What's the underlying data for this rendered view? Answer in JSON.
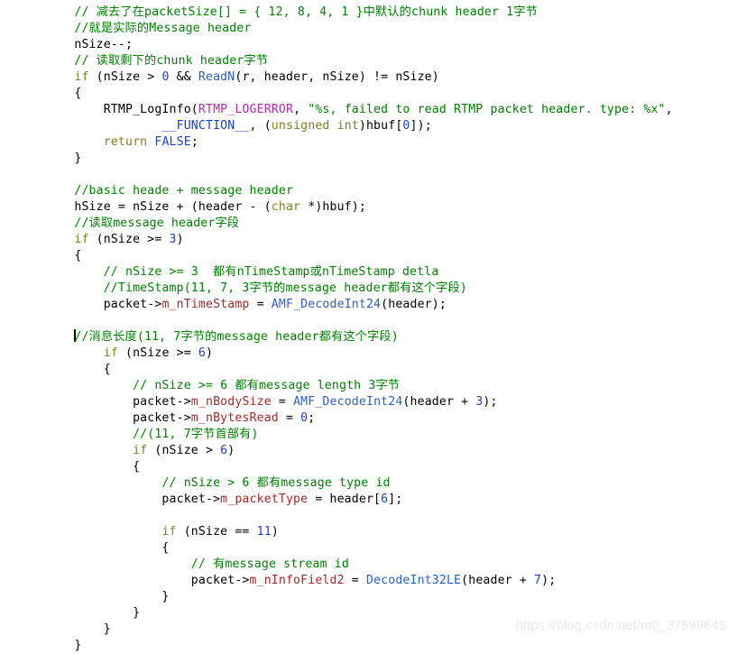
{
  "app": {
    "type": "code-editor-screenshot",
    "language": "C",
    "background_color": "#ffffff"
  },
  "theme": {
    "comment_color": "#008000",
    "keyword_color": "#7f7f23",
    "number_color": "#1c41c8",
    "function_color": "#2a5fc4",
    "member_color": "#9e2b2b",
    "macro_color": "#b02fb0",
    "string_color": "#008000",
    "plain_color": "#000000",
    "caret_color": "#000000",
    "watermark_color": "#e9e9e9"
  },
  "caret": {
    "visible": true,
    "line_index": 20,
    "column": 4
  },
  "watermark": {
    "text": "https://blog.csdn.net/m0_37599645"
  },
  "code": {
    "lines": [
      {
        "i": 0,
        "text": "    // 减去了在packetSize[] = { 12, 8, 4, 1 }中默认的chunk header 1字节"
      },
      {
        "i": 1,
        "text": "    //就是实际的Message header"
      },
      {
        "i": 2,
        "text": "    nSize--;"
      },
      {
        "i": 3,
        "text": "    // 读取剩下的chunk header字节"
      },
      {
        "i": 4,
        "text": "    if (nSize > 0 && ReadN(r, header, nSize) != nSize)"
      },
      {
        "i": 5,
        "text": "    {"
      },
      {
        "i": 6,
        "text": "        RTMP_LogInfo(RTMP_LOGERROR, \"%s, failed to read RTMP packet header. type: %x\","
      },
      {
        "i": 7,
        "text": "                __FUNCTION__, (unsigned int)hbuf[0]);"
      },
      {
        "i": 8,
        "text": "        return FALSE;"
      },
      {
        "i": 9,
        "text": "    }"
      },
      {
        "i": 10,
        "text": ""
      },
      {
        "i": 11,
        "text": "    //basic heade + message header"
      },
      {
        "i": 12,
        "text": "    hSize = nSize + (header - (char *)hbuf);"
      },
      {
        "i": 13,
        "text": "    //读取message header字段"
      },
      {
        "i": 14,
        "text": "    if (nSize >= 3)"
      },
      {
        "i": 15,
        "text": "    {"
      },
      {
        "i": 16,
        "text": "        // nSize >= 3  都有nTimeStamp或nTimeStamp detla"
      },
      {
        "i": 17,
        "text": "        //TimeStamp(11, 7, 3字节的message header都有这个字段)"
      },
      {
        "i": 18,
        "text": "        packet->m_nTimeStamp = AMF_DecodeInt24(header);"
      },
      {
        "i": 19,
        "text": ""
      },
      {
        "i": 20,
        "text": "    //消息长度(11, 7字节的message header都有这个字段)"
      },
      {
        "i": 21,
        "text": "        if (nSize >= 6)"
      },
      {
        "i": 22,
        "text": "        {"
      },
      {
        "i": 23,
        "text": "            // nSize >= 6 都有message length 3字节"
      },
      {
        "i": 24,
        "text": "            packet->m_nBodySize = AMF_DecodeInt24(header + 3);"
      },
      {
        "i": 25,
        "text": "            packet->m_nBytesRead = 0;"
      },
      {
        "i": 26,
        "text": "            //(11, 7字节首部有)"
      },
      {
        "i": 27,
        "text": "            if (nSize > 6)"
      },
      {
        "i": 28,
        "text": "            {"
      },
      {
        "i": 29,
        "text": "                // nSize > 6 都有message type id"
      },
      {
        "i": 30,
        "text": "                packet->m_packetType = header[6];"
      },
      {
        "i": 31,
        "text": ""
      },
      {
        "i": 32,
        "text": "                if (nSize == 11)"
      },
      {
        "i": 33,
        "text": "                {"
      },
      {
        "i": 34,
        "text": "                    // 有message stream id"
      },
      {
        "i": 35,
        "text": "                    packet->m_nInfoField2 = DecodeInt32LE(header + 7);"
      },
      {
        "i": 36,
        "text": "                }"
      },
      {
        "i": 37,
        "text": "            }"
      },
      {
        "i": 38,
        "text": "        }"
      },
      {
        "i": 39,
        "text": "    }"
      }
    ],
    "tokens": [
      [
        {
          "t": "    ",
          "c": "p"
        },
        {
          "t": "// 减去了在packetSize[] = { 12, 8, 4, 1 }中默认的chunk header 1字节",
          "c": "c"
        }
      ],
      [
        {
          "t": "    ",
          "c": "p"
        },
        {
          "t": "//就是实际的Message header",
          "c": "c"
        }
      ],
      [
        {
          "t": "    nSize--;",
          "c": "p"
        }
      ],
      [
        {
          "t": "    ",
          "c": "p"
        },
        {
          "t": "// 读取剩下的chunk header字节",
          "c": "c"
        }
      ],
      [
        {
          "t": "    ",
          "c": "p"
        },
        {
          "t": "if",
          "c": "k"
        },
        {
          "t": " (nSize > ",
          "c": "p"
        },
        {
          "t": "0",
          "c": "n"
        },
        {
          "t": " && ",
          "c": "p"
        },
        {
          "t": "ReadN",
          "c": "fn"
        },
        {
          "t": "(r, header, nSize) != nSize)",
          "c": "p"
        }
      ],
      [
        {
          "t": "    {",
          "c": "p"
        }
      ],
      [
        {
          "t": "        ",
          "c": "p"
        },
        {
          "t": "RTMP_LogInfo",
          "c": "p"
        },
        {
          "t": "(",
          "c": "p"
        },
        {
          "t": "RTMP_LOGERROR",
          "c": "mac"
        },
        {
          "t": ", ",
          "c": "p"
        },
        {
          "t": "\"%s, failed to read RTMP packet header. type: %x\"",
          "c": "str"
        },
        {
          "t": ",",
          "c": "p"
        }
      ],
      [
        {
          "t": "                ",
          "c": "p"
        },
        {
          "t": "__FUNCTION__",
          "c": "cst"
        },
        {
          "t": ", (",
          "c": "p"
        },
        {
          "t": "unsigned int",
          "c": "k"
        },
        {
          "t": ")hbuf[",
          "c": "p"
        },
        {
          "t": "0",
          "c": "n"
        },
        {
          "t": "]);",
          "c": "p"
        }
      ],
      [
        {
          "t": "        ",
          "c": "p"
        },
        {
          "t": "return",
          "c": "k"
        },
        {
          "t": " ",
          "c": "p"
        },
        {
          "t": "FALSE",
          "c": "cst"
        },
        {
          "t": ";",
          "c": "p"
        }
      ],
      [
        {
          "t": "    }",
          "c": "p"
        }
      ],
      [
        {
          "t": "",
          "c": "p"
        }
      ],
      [
        {
          "t": "    ",
          "c": "p"
        },
        {
          "t": "//basic heade + message header",
          "c": "c"
        }
      ],
      [
        {
          "t": "    hSize = nSize + (header - (",
          "c": "p"
        },
        {
          "t": "char",
          "c": "k"
        },
        {
          "t": " *)hbuf);",
          "c": "p"
        }
      ],
      [
        {
          "t": "    ",
          "c": "p"
        },
        {
          "t": "//读取message header字段",
          "c": "c"
        }
      ],
      [
        {
          "t": "    ",
          "c": "p"
        },
        {
          "t": "if",
          "c": "k"
        },
        {
          "t": " (nSize >= ",
          "c": "p"
        },
        {
          "t": "3",
          "c": "n"
        },
        {
          "t": ")",
          "c": "p"
        }
      ],
      [
        {
          "t": "    {",
          "c": "p"
        }
      ],
      [
        {
          "t": "        ",
          "c": "p"
        },
        {
          "t": "// nSize >= 3  都有nTimeStamp或nTimeStamp detla",
          "c": "c"
        }
      ],
      [
        {
          "t": "        ",
          "c": "p"
        },
        {
          "t": "//TimeStamp(11, 7, 3字节的message header都有这个字段)",
          "c": "c"
        }
      ],
      [
        {
          "t": "        packet->",
          "c": "p"
        },
        {
          "t": "m_nTimeStamp",
          "c": "mem"
        },
        {
          "t": " = ",
          "c": "p"
        },
        {
          "t": "AMF_DecodeInt24",
          "c": "fn"
        },
        {
          "t": "(header);",
          "c": "p"
        }
      ],
      [
        {
          "t": "",
          "c": "p"
        }
      ],
      [
        {
          "t": "    ",
          "c": "p"
        },
        {
          "t": "CARET",
          "c": "caret"
        },
        {
          "t": "//消息长度(11, 7字节的message header都有这个字段)",
          "c": "c"
        }
      ],
      [
        {
          "t": "        ",
          "c": "p"
        },
        {
          "t": "if",
          "c": "k"
        },
        {
          "t": " (nSize >= ",
          "c": "p"
        },
        {
          "t": "6",
          "c": "n"
        },
        {
          "t": ")",
          "c": "p"
        }
      ],
      [
        {
          "t": "        {",
          "c": "p"
        }
      ],
      [
        {
          "t": "            ",
          "c": "p"
        },
        {
          "t": "// nSize >= 6 都有message length 3字节",
          "c": "c"
        }
      ],
      [
        {
          "t": "            packet->",
          "c": "p"
        },
        {
          "t": "m_nBodySize",
          "c": "mem"
        },
        {
          "t": " = ",
          "c": "p"
        },
        {
          "t": "AMF_DecodeInt24",
          "c": "fn"
        },
        {
          "t": "(header + ",
          "c": "p"
        },
        {
          "t": "3",
          "c": "n"
        },
        {
          "t": ");",
          "c": "p"
        }
      ],
      [
        {
          "t": "            packet->",
          "c": "p"
        },
        {
          "t": "m_nBytesRead",
          "c": "mem"
        },
        {
          "t": " = ",
          "c": "p"
        },
        {
          "t": "0",
          "c": "n"
        },
        {
          "t": ";",
          "c": "p"
        }
      ],
      [
        {
          "t": "            ",
          "c": "p"
        },
        {
          "t": "//(11, 7字节首部有)",
          "c": "c"
        }
      ],
      [
        {
          "t": "            ",
          "c": "p"
        },
        {
          "t": "if",
          "c": "k"
        },
        {
          "t": " (nSize > ",
          "c": "p"
        },
        {
          "t": "6",
          "c": "n"
        },
        {
          "t": ")",
          "c": "p"
        }
      ],
      [
        {
          "t": "            {",
          "c": "p"
        }
      ],
      [
        {
          "t": "                ",
          "c": "p"
        },
        {
          "t": "// nSize > 6 都有message type id",
          "c": "c"
        }
      ],
      [
        {
          "t": "                packet->",
          "c": "p"
        },
        {
          "t": "m_packetType",
          "c": "mem"
        },
        {
          "t": " = header[",
          "c": "p"
        },
        {
          "t": "6",
          "c": "n"
        },
        {
          "t": "];",
          "c": "p"
        }
      ],
      [
        {
          "t": "",
          "c": "p"
        }
      ],
      [
        {
          "t": "                ",
          "c": "p"
        },
        {
          "t": "if",
          "c": "k"
        },
        {
          "t": " (nSize == ",
          "c": "p"
        },
        {
          "t": "11",
          "c": "n"
        },
        {
          "t": ")",
          "c": "p"
        }
      ],
      [
        {
          "t": "                {",
          "c": "p"
        }
      ],
      [
        {
          "t": "                    ",
          "c": "p"
        },
        {
          "t": "// 有message stream id",
          "c": "c"
        }
      ],
      [
        {
          "t": "                    packet->",
          "c": "p"
        },
        {
          "t": "m_nInfoField2",
          "c": "mem"
        },
        {
          "t": " = ",
          "c": "p"
        },
        {
          "t": "DecodeInt32LE",
          "c": "fn"
        },
        {
          "t": "(header + ",
          "c": "p"
        },
        {
          "t": "7",
          "c": "n"
        },
        {
          "t": ");",
          "c": "p"
        }
      ],
      [
        {
          "t": "                }",
          "c": "p"
        }
      ],
      [
        {
          "t": "            }",
          "c": "p"
        }
      ],
      [
        {
          "t": "        }",
          "c": "p"
        }
      ],
      [
        {
          "t": "    }",
          "c": "p"
        }
      ]
    ]
  }
}
